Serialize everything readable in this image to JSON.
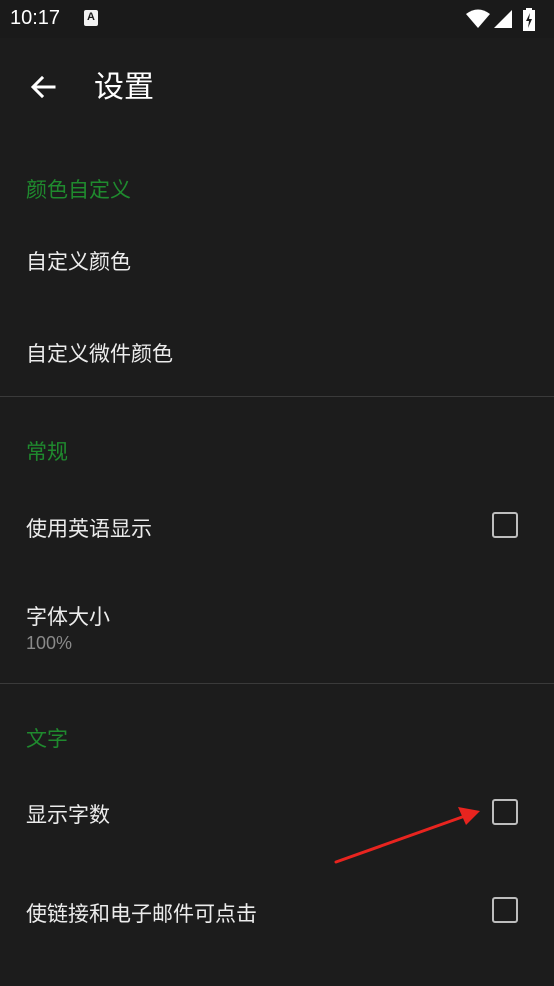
{
  "status_bar": {
    "time": "10:17",
    "notification_icon_letter": "A"
  },
  "app_bar": {
    "title": "设置",
    "back_icon": "arrow-back-icon"
  },
  "sections": [
    {
      "header": "颜色自定义",
      "items": [
        {
          "title": "自定义颜色"
        },
        {
          "title": "自定义微件颜色"
        }
      ]
    },
    {
      "header": "常规",
      "items": [
        {
          "title": "使用英语显示",
          "checked": false
        },
        {
          "title": "字体大小",
          "summary": "100%"
        }
      ]
    },
    {
      "header": "文字",
      "items": [
        {
          "title": "显示字数",
          "checked": false
        },
        {
          "title": "使链接和电子邮件可点击",
          "checked": false
        }
      ]
    }
  ],
  "colors": {
    "background": "#1c1c1c",
    "section_header": "#1f8a2e",
    "annotation_arrow": "#e8241f"
  }
}
